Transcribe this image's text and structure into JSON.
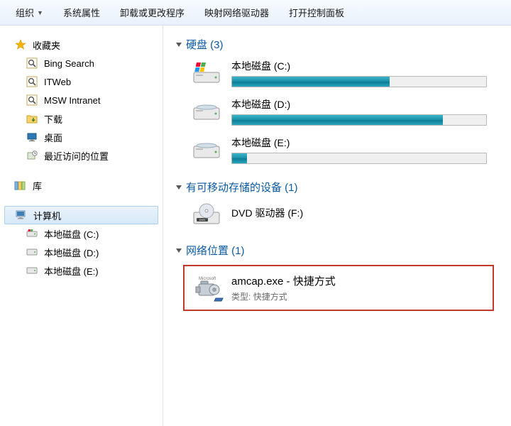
{
  "toolbar": {
    "organize": "组织",
    "sysprops": "系统属性",
    "uninstall": "卸载或更改程序",
    "mapnet": "映射网络驱动器",
    "opencp": "打开控制面板"
  },
  "nav": {
    "favorites": "收藏夹",
    "bing": "Bing Search",
    "itweb": "ITWeb",
    "msw": "MSW Intranet",
    "downloads": "下载",
    "desktop": "桌面",
    "recent": "最近访问的位置",
    "libraries": "库",
    "computer": "计算机",
    "driveC": "本地磁盘 (C:)",
    "driveD": "本地磁盘 (D:)",
    "driveE": "本地磁盘 (E:)"
  },
  "main": {
    "hdd_header": "硬盘 (3)",
    "c_name": "本地磁盘 (C:)",
    "d_name": "本地磁盘 (D:)",
    "e_name": "本地磁盘 (E:)",
    "rem_header": "有可移动存储的设备 (1)",
    "dvd_name": "DVD 驱动器 (F:)",
    "net_header": "网络位置 (1)",
    "amcap_name": "amcap.exe - 快捷方式",
    "amcap_type_label": "类型:",
    "amcap_type_value": "快捷方式",
    "ms_label": "Microsoft"
  },
  "fill": {
    "c": "62%",
    "d": "83%",
    "e": "6%"
  }
}
